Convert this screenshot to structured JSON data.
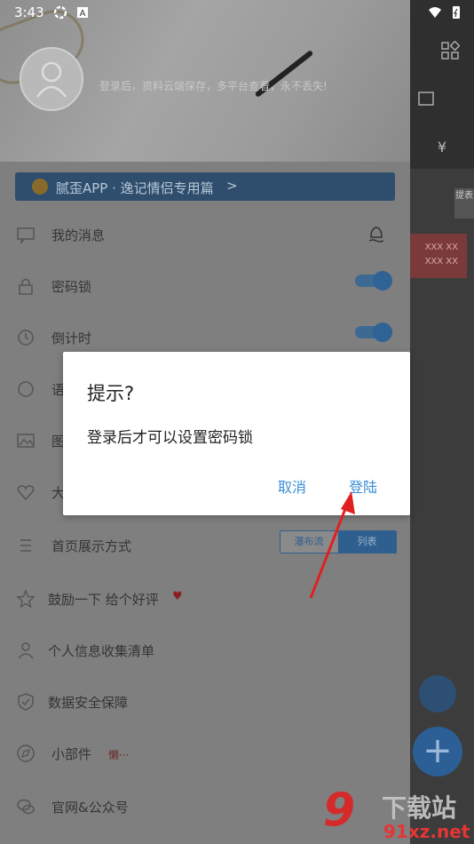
{
  "status_bar": {
    "time": "3:43",
    "icons": [
      "gear-icon",
      "a-badge-icon",
      "wifi-icon",
      "battery-icon"
    ]
  },
  "background_app": {
    "side_tag": "提表",
    "red_card_lines": [
      "XXX XX",
      "XXX XX"
    ],
    "currency_symbol": "¥",
    "plus_symbol": "+"
  },
  "drawer": {
    "login_prompt": "登录后，资料云端保存，多平台查看，永不丢失!",
    "banner": {
      "label": "腻歪APP · 逸记情侣专用篇",
      "chevron": ">"
    },
    "menu": [
      {
        "label": "我的消息",
        "icon": "message-icon",
        "right_icon": "notification-icon"
      },
      {
        "label": "密码锁",
        "icon": "lock-icon",
        "toggle": true
      },
      {
        "label": "倒计时",
        "icon": "clock-icon",
        "toggle": true
      },
      {
        "label": "语",
        "icon": "voice-icon"
      },
      {
        "label": "图",
        "icon": "image-icon"
      },
      {
        "label": "大",
        "icon": "heart-icon"
      },
      {
        "label": "首页展示方式",
        "icon": "list-icon",
        "segment": [
          "瀑布流",
          "列表"
        ],
        "selected": "列表"
      },
      {
        "label": "鼓励一下 给个好评",
        "icon": "star-icon",
        "extra_symbol": "♥"
      },
      {
        "label": "个人信息收集清单",
        "icon": "person-icon"
      },
      {
        "label": "数据安全保障",
        "icon": "shield-icon"
      },
      {
        "label": "小部件",
        "icon": "compass-icon",
        "hint": "懒···"
      },
      {
        "label": "官网&公众号",
        "icon": "wechat-icon"
      }
    ]
  },
  "dialog": {
    "title": "提示?",
    "message": "登录后才可以设置密码锁",
    "cancel": "取消",
    "confirm": "登陆"
  },
  "watermark": {
    "logo": "9",
    "text": "下载站",
    "domain": "91xz.net"
  },
  "colors": {
    "accent": "#3c8ed8",
    "arrow": "#e02020",
    "dim_overlay": "#7f7f7f"
  }
}
